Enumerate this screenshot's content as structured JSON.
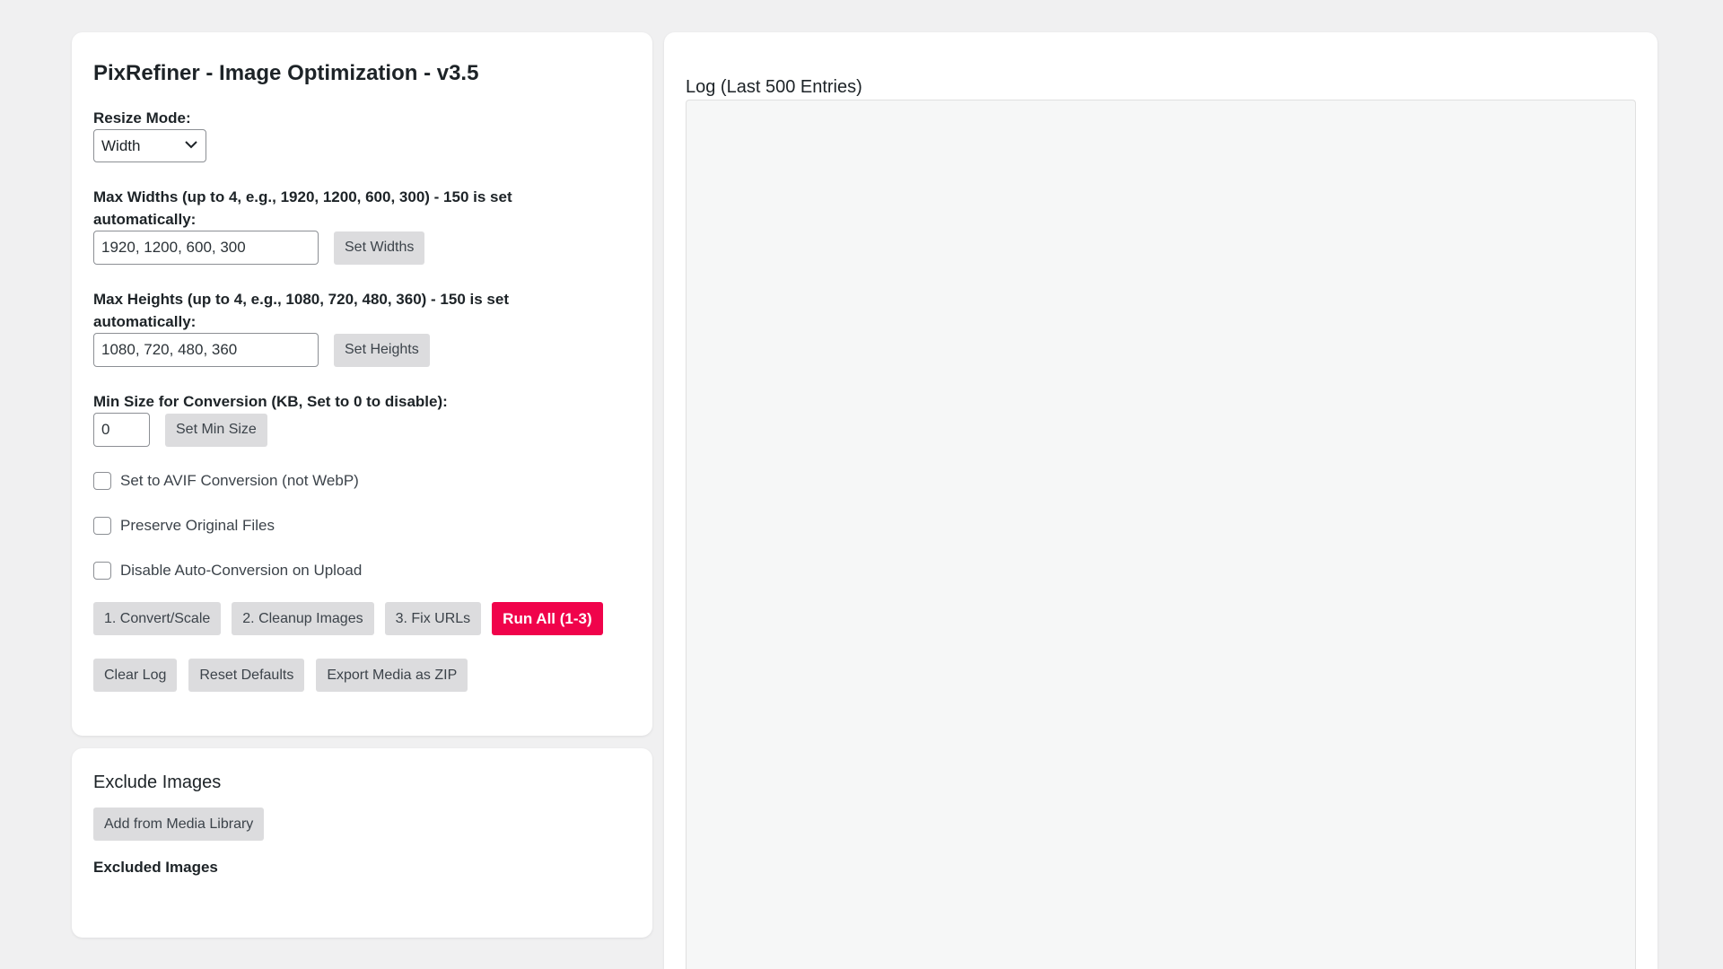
{
  "settings": {
    "title": "PixRefiner - Image Optimization - v3.5",
    "resize_mode_label": "Resize Mode:",
    "resize_mode_value": "Width",
    "max_widths_label": "Max Widths (up to 4, e.g., 1920, 1200, 600, 300) - 150 is set automatically:",
    "max_widths_value": "1920, 1200, 600, 300",
    "set_widths_label": "Set Widths",
    "max_heights_label": "Max Heights (up to 4, e.g., 1080, 720, 480, 360) - 150 is set automatically:",
    "max_heights_value": "1080, 720, 480, 360",
    "set_heights_label": "Set Heights",
    "min_size_label": "Min Size for Conversion (KB, Set to 0 to disable):",
    "min_size_value": "0",
    "set_min_size_label": "Set Min Size",
    "checkboxes": [
      {
        "label": "Set to AVIF Conversion (not WebP)",
        "checked": false
      },
      {
        "label": "Preserve Original Files",
        "checked": false
      },
      {
        "label": "Disable Auto-Conversion on Upload",
        "checked": false
      }
    ],
    "action_buttons": {
      "convert": "1. Convert/Scale",
      "cleanup": "2. Cleanup Images",
      "fix_urls": "3. Fix URLs",
      "run_all": "Run All (1-3)"
    },
    "utility_buttons": {
      "clear_log": "Clear Log",
      "reset_defaults": "Reset Defaults",
      "export_zip": "Export Media as ZIP"
    }
  },
  "exclude": {
    "title": "Exclude Images",
    "add_button": "Add from Media Library",
    "excluded_heading": "Excluded Images"
  },
  "log": {
    "title": "Log (Last 500 Entries)"
  },
  "colors": {
    "accent": "#f0034b",
    "background": "#f0f0f1",
    "button": "#dcdcde"
  }
}
